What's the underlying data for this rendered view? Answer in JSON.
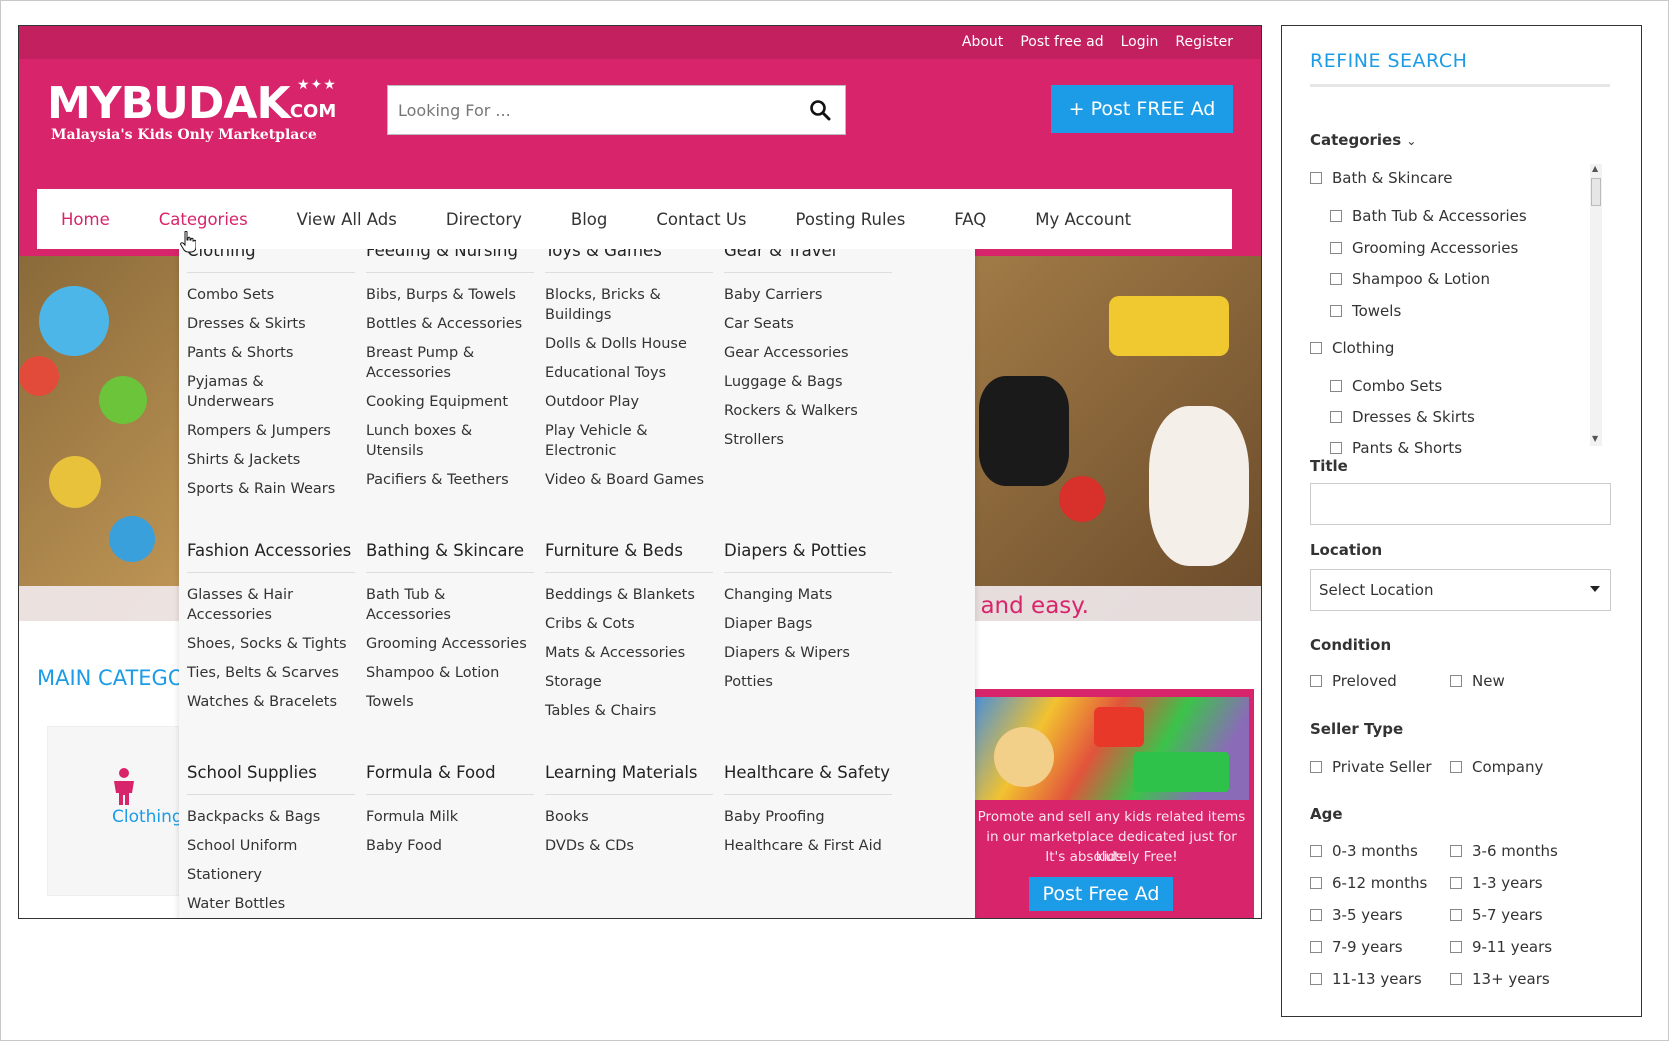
{
  "top_links": [
    "About",
    "Post free ad",
    "Login",
    "Register"
  ],
  "logo": {
    "name": "MYBUDAK",
    "com": ".COM",
    "tagline": "Malaysia's Kids Only Marketplace"
  },
  "search": {
    "placeholder": "Looking For ..."
  },
  "post_ad_button": "+ Post FREE Ad",
  "nav": [
    "Home",
    "Categories",
    "View All Ads",
    "Directory",
    "Blog",
    "Contact Us",
    "Posting Rules",
    "FAQ",
    "My Account"
  ],
  "hero_text": "e and easy.",
  "main_categories": "MAIN CATEGO",
  "category_card": "Clothing",
  "mega_menu": [
    {
      "title": "Clothing",
      "items": [
        "Combo Sets",
        "Dresses & Skirts",
        "Pants & Shorts",
        "Pyjamas & Underwears",
        "Rompers & Jumpers",
        "Shirts & Jackets",
        "Sports & Rain Wears"
      ]
    },
    {
      "title": "Feeding & Nursing",
      "items": [
        "Bibs, Burps & Towels",
        "Bottles & Accessories",
        "Breast Pump & Accessories",
        "Cooking Equipment",
        "Lunch boxes & Utensils",
        "Pacifiers & Teethers"
      ]
    },
    {
      "title": "Toys & Games",
      "items": [
        "Blocks, Bricks & Buildings",
        "Dolls & Dolls House",
        "Educational Toys",
        "Outdoor Play",
        "Play Vehicle & Electronic",
        "Video & Board Games"
      ]
    },
    {
      "title": "Gear & Travel",
      "items": [
        "Baby Carriers",
        "Car Seats",
        "Gear Accessories",
        "Luggage & Bags",
        "Rockers & Walkers",
        "Strollers"
      ]
    },
    {
      "title": "Fashion Accessories",
      "items": [
        "Glasses & Hair Accessories",
        "Shoes, Socks & Tights",
        "Ties, Belts & Scarves",
        "Watches & Bracelets"
      ]
    },
    {
      "title": "Bathing & Skincare",
      "items": [
        "Bath Tub & Accessories",
        "Grooming Accessories",
        "Shampoo & Lotion",
        "Towels"
      ]
    },
    {
      "title": "Furniture & Beds",
      "items": [
        "Beddings & Blankets",
        "Cribs & Cots",
        "Mats & Accessories",
        "Storage",
        "Tables & Chairs"
      ]
    },
    {
      "title": "Diapers & Potties",
      "items": [
        "Changing Mats",
        "Diaper Bags",
        "Diapers & Wipers",
        "Potties"
      ]
    },
    {
      "title": "School Supplies",
      "items": [
        "Backpacks & Bags",
        "School Uniform",
        "Stationery",
        "Water Bottles"
      ]
    },
    {
      "title": "Formula & Food",
      "items": [
        "Formula Milk",
        "Baby Food"
      ]
    },
    {
      "title": "Learning Materials",
      "items": [
        "Books",
        "DVDs & CDs"
      ]
    },
    {
      "title": "Healthcare & Safety",
      "items": [
        "Baby Proofing",
        "Healthcare & First Aid"
      ]
    }
  ],
  "promo": {
    "text": "Promote and sell any kids related items in our marketplace dedicated just for kids.",
    "free": "It's absolutely Free!",
    "button": "Post Free Ad"
  },
  "refine": {
    "title": "REFINE SEARCH",
    "categories_label": "Categories",
    "category_tree": [
      {
        "label": "Bath & Skincare",
        "level": 0
      },
      {
        "label": "Bath Tub & Accessories",
        "level": 1
      },
      {
        "label": "Grooming Accessories",
        "level": 1
      },
      {
        "label": "Shampoo & Lotion",
        "level": 1
      },
      {
        "label": "Towels",
        "level": 1
      },
      {
        "label": "Clothing",
        "level": 0
      },
      {
        "label": "Combo Sets",
        "level": 1
      },
      {
        "label": "Dresses & Skirts",
        "level": 1
      },
      {
        "label": "Pants & Shorts",
        "level": 1
      }
    ],
    "title_label": "Title",
    "title_value": "",
    "location_label": "Location",
    "location_value": "Select Location",
    "condition_label": "Condition",
    "condition_options": [
      "Preloved",
      "New"
    ],
    "seller_label": "Seller Type",
    "seller_options": [
      "Private Seller",
      "Company"
    ],
    "age_label": "Age",
    "age_options": [
      "0-3 months",
      "3-6 months",
      "6-12 months",
      "1-3 years",
      "3-5 years",
      "5-7 years",
      "7-9 years",
      "9-11 years",
      "11-13 years",
      "13+ years"
    ]
  },
  "colors": {
    "brand_pink": "#d8246a",
    "topbar_pink": "#c2205f",
    "accent_blue": "#1c9ce6"
  }
}
